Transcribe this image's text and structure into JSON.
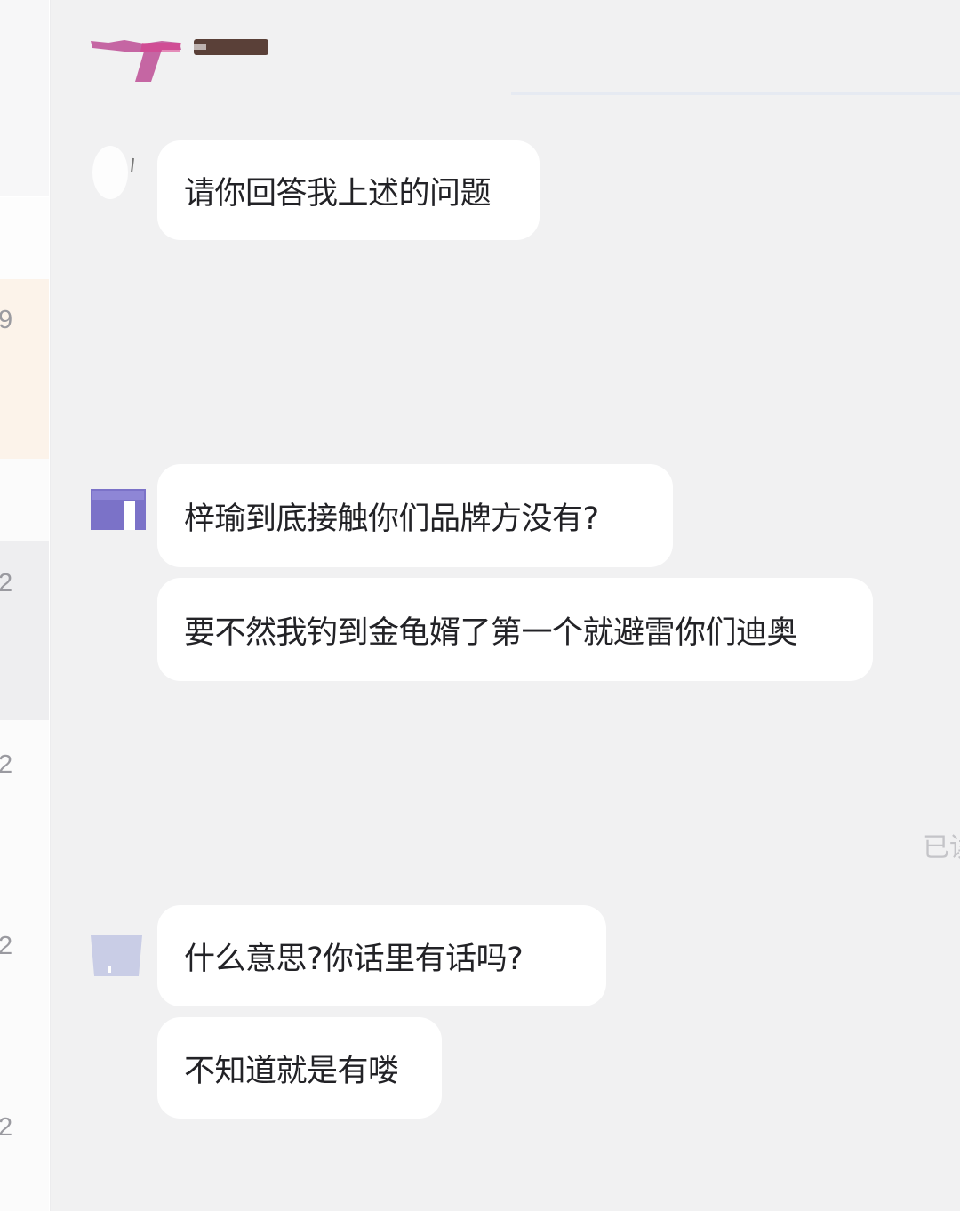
{
  "sidebar": {
    "counts": [
      "9",
      "2",
      "2",
      "2",
      "2"
    ]
  },
  "chat": {
    "messages": [
      {
        "text": "请你回答我上述的问题"
      },
      {
        "text": "梓瑜到底接触你们品牌方没有?"
      },
      {
        "text": "要不然我钓到金龟婿了第一个就避雷你们迪奥"
      },
      {
        "text": "什么意思?你话里有话吗?"
      },
      {
        "text": "不知道就是有喽"
      }
    ],
    "read_status": "已读"
  },
  "colors": {
    "background": "#f1f1f2",
    "bubble": "#ffffff",
    "avatar_purple": "#7b72c8",
    "avatar_light": "#c9cde6",
    "logo_pink": "#c0569a"
  }
}
